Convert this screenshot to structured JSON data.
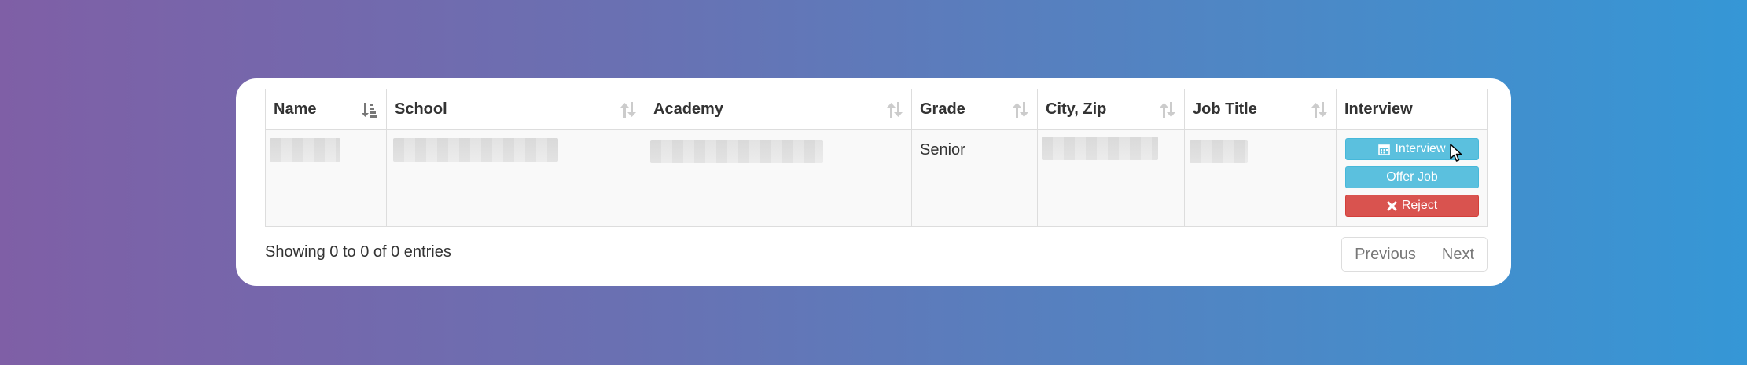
{
  "table": {
    "columns": [
      {
        "label": "Name",
        "sort_icon": "sort-amount-asc-icon"
      },
      {
        "label": "School",
        "sort_icon": "sort-icon"
      },
      {
        "label": "Academy",
        "sort_icon": "sort-icon"
      },
      {
        "label": "Grade",
        "sort_icon": "sort-icon"
      },
      {
        "label": "City, Zip",
        "sort_icon": "sort-icon"
      },
      {
        "label": "Job Title",
        "sort_icon": "sort-icon"
      },
      {
        "label": "Interview",
        "sort_icon": ""
      }
    ],
    "rows": [
      {
        "name": "",
        "school": "",
        "academy": "",
        "grade": "Senior",
        "city_zip": "",
        "job_title": "",
        "actions": {
          "interview_label": "Interview",
          "offer_label": "Offer Job",
          "reject_label": "Reject"
        }
      }
    ]
  },
  "footer": {
    "info": "Showing 0 to 0 of 0 entries",
    "previous_label": "Previous",
    "next_label": "Next"
  },
  "colors": {
    "info": "#5bc0de",
    "danger": "#d9534f",
    "gradient_start": "#7f5fa6",
    "gradient_end": "#3597d6"
  }
}
